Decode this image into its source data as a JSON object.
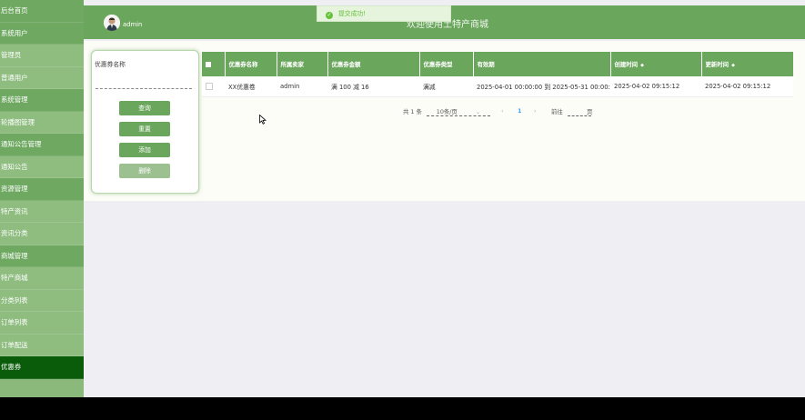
{
  "sidebar": {
    "items": [
      {
        "label": "后台首页",
        "kind": "group"
      },
      {
        "label": "系统用户",
        "kind": "group"
      },
      {
        "label": "管理员",
        "kind": "sub"
      },
      {
        "label": "普通用户",
        "kind": "sub"
      },
      {
        "label": "系统管理",
        "kind": "group"
      },
      {
        "label": "轮播图管理",
        "kind": "sub"
      },
      {
        "label": "通知公告管理",
        "kind": "group"
      },
      {
        "label": "通知公告",
        "kind": "sub"
      },
      {
        "label": "资源管理",
        "kind": "group"
      },
      {
        "label": "特产资讯",
        "kind": "sub"
      },
      {
        "label": "资讯分类",
        "kind": "sub"
      },
      {
        "label": "商城管理",
        "kind": "group"
      },
      {
        "label": "特产商城",
        "kind": "sub"
      },
      {
        "label": "分类列表",
        "kind": "sub"
      },
      {
        "label": "订单列表",
        "kind": "sub"
      },
      {
        "label": "订单配送",
        "kind": "sub"
      },
      {
        "label": "优惠券",
        "kind": "active"
      }
    ]
  },
  "header": {
    "username": "admin",
    "welcome": "欢迎使用土特产商城"
  },
  "toast": {
    "icon": "check-circle-icon",
    "message": "提交成功!"
  },
  "search": {
    "field_label": "优惠券名称",
    "field_value": "",
    "buttons": {
      "query": "查询",
      "reset": "重置",
      "add": "添加",
      "delete": "删除"
    }
  },
  "table": {
    "columns": [
      "优惠券名称",
      "所属卖家",
      "优惠券金额",
      "优惠券类型",
      "有效期",
      "创建时间",
      "更新时间"
    ],
    "sortable": [
      false,
      false,
      false,
      false,
      false,
      true,
      true
    ],
    "rows": [
      {
        "name": "XX优惠卷",
        "seller": "admin",
        "amount": "满 100 减 16",
        "type": "满减",
        "validity": "2025-04-01 00:00:00 到 2025-05-31 00:00:00",
        "created": "2025-04-02 09:15:12",
        "updated": "2025-04-02 09:15:12"
      }
    ]
  },
  "pagination": {
    "total": "共 1 条",
    "page_size": "10条/页",
    "prev": "‹",
    "current_page": "1",
    "next": "›",
    "goto_label": "前往",
    "goto_value": "",
    "goto_suffix": "页"
  },
  "colors": {
    "primary": "#6aa65c",
    "sidebar": "#8bb87b",
    "active": "#0a5b0a",
    "toast_text": "#67c23a"
  }
}
